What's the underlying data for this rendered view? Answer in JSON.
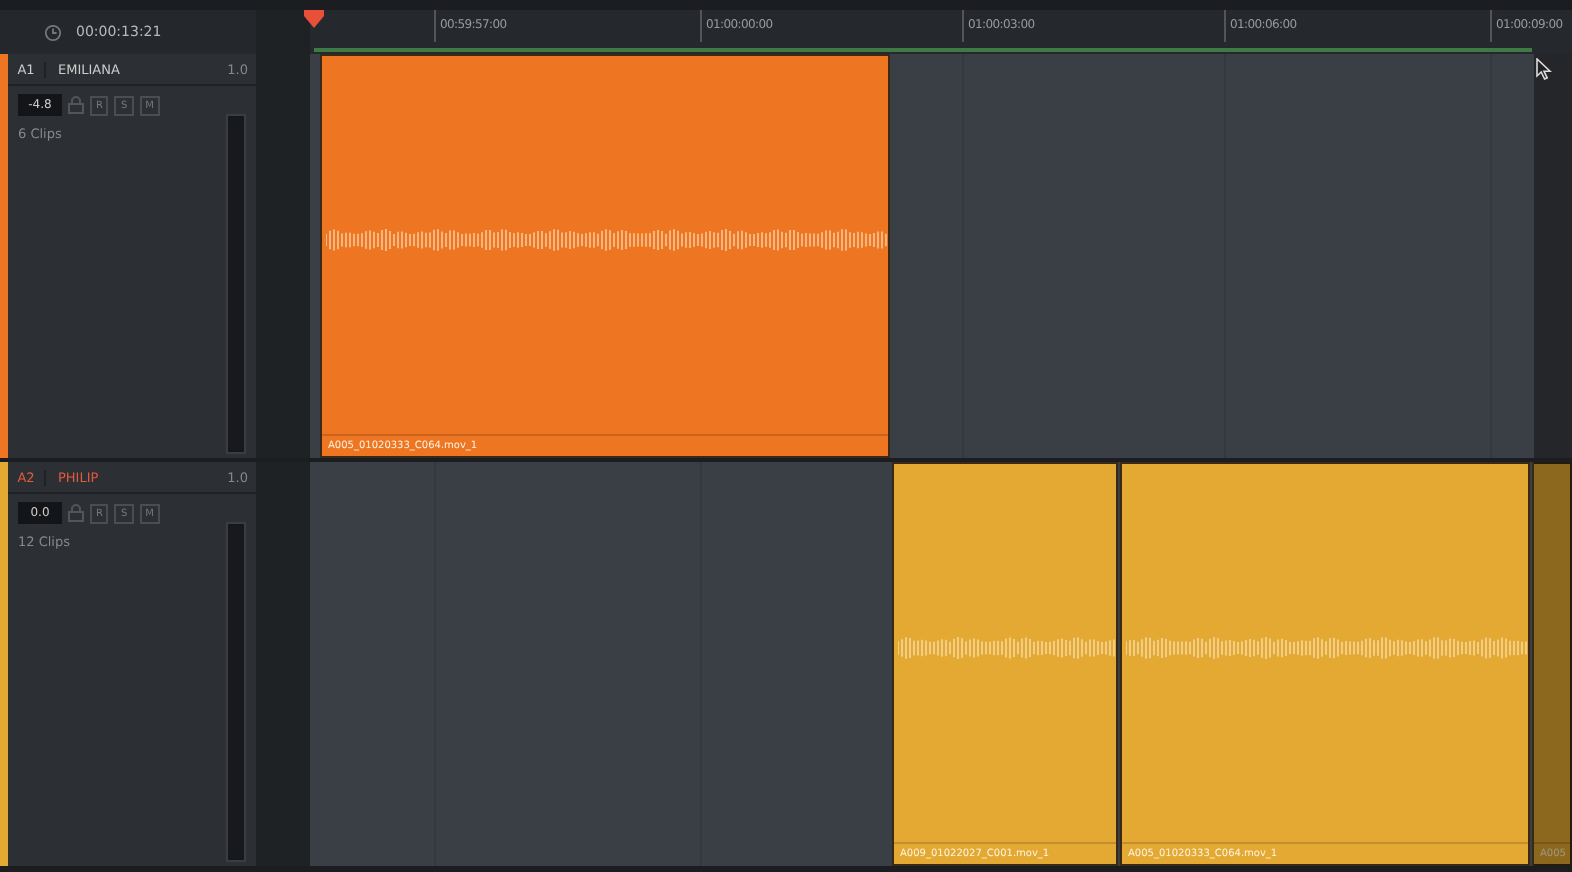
{
  "header": {
    "timecode": "00:00:13:21"
  },
  "ruler": {
    "ticks": [
      "00:59:57:00",
      "01:00:00:00",
      "01:00:03:00",
      "01:00:06:00",
      "01:00:09:00"
    ]
  },
  "tracks": [
    {
      "id": "A1",
      "name": "EMILIANA",
      "selected": false,
      "gain": "1.0",
      "volume": "-4.8",
      "buttons": [
        "R",
        "S",
        "M"
      ],
      "clip_count": "6 Clips",
      "color": "#ee7623",
      "clips": [
        {
          "name": "A005_01020333_C064.mov_1",
          "dimmed": false
        }
      ]
    },
    {
      "id": "A2",
      "name": "PHILIP",
      "selected": true,
      "gain": "1.0",
      "volume": "0.0",
      "buttons": [
        "R",
        "S",
        "M"
      ],
      "clip_count": "12 Clips",
      "color": "#e3a933",
      "clips": [
        {
          "name": "A009_01022027_C001.mov_1",
          "dimmed": false
        },
        {
          "name": "A005_01020333_C064.mov_1",
          "dimmed": false
        },
        {
          "name": "A005",
          "dimmed": true
        }
      ]
    }
  ]
}
